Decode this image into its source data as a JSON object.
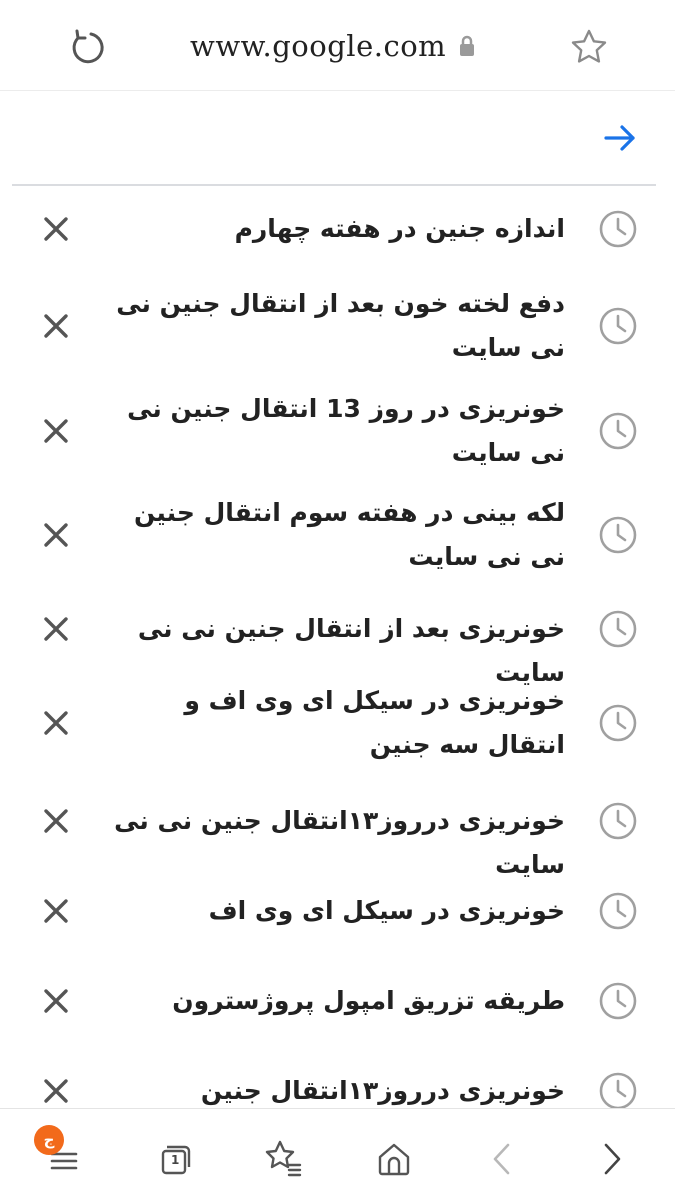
{
  "address_bar": {
    "url": "www.google.com",
    "reload_icon": "reload-icon",
    "lock_icon": "lock-icon",
    "bookmark_icon": "star-icon"
  },
  "search": {
    "go_icon": "arrow-right-icon",
    "accent_color": "#1a73e8"
  },
  "history": {
    "items": [
      {
        "text": "اندازه جنین در هفته چهارم"
      },
      {
        "text": "دفع لخته خون بعد از انتقال جنین نی نی سایت"
      },
      {
        "text": "خونریزی در روز 13 انتقال جنین نی نی سایت"
      },
      {
        "text": "لکه بینی در هفته سوم انتقال جنین نی نی سایت"
      },
      {
        "text": "خونریزی بعد از انتقال جنین نی نی سایت"
      },
      {
        "text": "خونریزی در سیکل ای وی اف و انتقال سه جنین"
      },
      {
        "text": "خونریزی درروز۱۳انتقال جنین نی نی سایت"
      },
      {
        "text": "خونریزی در سیکل ای وی اف"
      },
      {
        "text": "طریقه تزریق امپول پروژسترون"
      },
      {
        "text": "خونریزی درروز۱۳انتقال جنین"
      }
    ],
    "item_icon": "history-clock-icon",
    "delete_icon": "close-icon"
  },
  "bottom_nav": {
    "menu_badge": "ج",
    "tab_count": "1",
    "badge_color": "#f26a1b",
    "icons": [
      "menu-icon",
      "tabs-icon",
      "bookmarks-icon",
      "home-icon",
      "back-icon",
      "forward-icon"
    ]
  }
}
